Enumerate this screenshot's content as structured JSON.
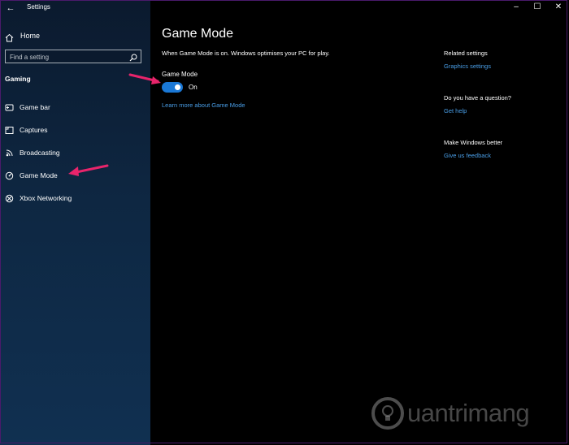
{
  "window": {
    "title": "Settings",
    "controls": {
      "minimize": "–",
      "maximize": "☐",
      "close": "✕"
    }
  },
  "sidebar": {
    "home_label": "Home",
    "search_placeholder": "Find a setting",
    "section_title": "Gaming",
    "items": [
      {
        "label": "Game bar",
        "icon": "game-bar-icon"
      },
      {
        "label": "Captures",
        "icon": "captures-icon"
      },
      {
        "label": "Broadcasting",
        "icon": "broadcasting-icon"
      },
      {
        "label": "Game Mode",
        "icon": "game-mode-icon"
      },
      {
        "label": "Xbox Networking",
        "icon": "xbox-icon"
      }
    ]
  },
  "main": {
    "title": "Game Mode",
    "description": "When Game Mode is on. Windows optimises your PC for play.",
    "toggle_label": "Game Mode",
    "toggle_state": "On",
    "toggle_on": true,
    "learn_more": "Learn more about Game Mode"
  },
  "related": {
    "heading": "Related settings",
    "link": "Graphics settings",
    "question_heading": "Do you have a question?",
    "help_link": "Get help",
    "better_heading": "Make Windows better",
    "feedback_link": "Give us feedback"
  },
  "watermark": {
    "text": "uantrimang"
  },
  "colors": {
    "accent": "#1a78d6",
    "link": "#4a9fe8",
    "arrow": "#e8246b"
  }
}
